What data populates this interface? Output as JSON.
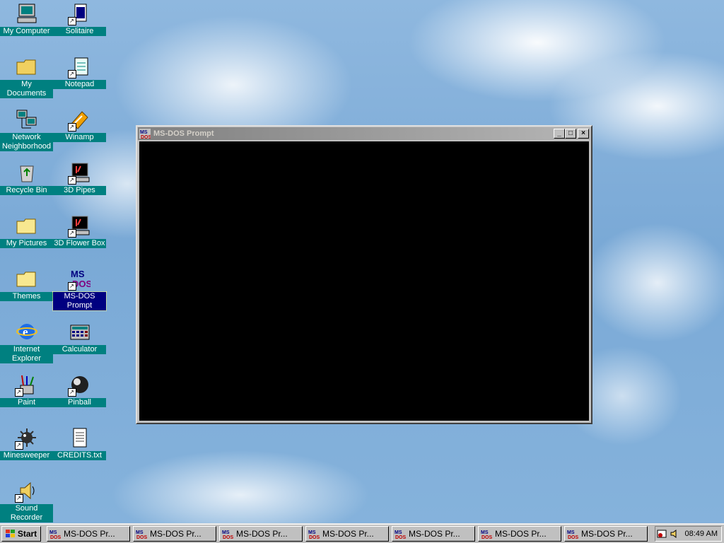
{
  "desktop": {
    "icons": [
      {
        "label": "My Computer"
      },
      {
        "label": "Solitaire"
      },
      {
        "label": "My Documents"
      },
      {
        "label": "Notepad"
      },
      {
        "label": "Network Neighborhood"
      },
      {
        "label": "Winamp"
      },
      {
        "label": "Recycle Bin"
      },
      {
        "label": "3D Pipes"
      },
      {
        "label": "My Pictures"
      },
      {
        "label": "3D Flower Box"
      },
      {
        "label": "Themes"
      },
      {
        "label": "MS-DOS Prompt"
      },
      {
        "label": "Internet Explorer"
      },
      {
        "label": "Calculator"
      },
      {
        "label": "Paint"
      },
      {
        "label": "Pinball"
      },
      {
        "label": "Minesweeper"
      },
      {
        "label": "CREDITS.txt"
      },
      {
        "label": "Sound Recorder"
      }
    ]
  },
  "window": {
    "title": "MS-DOS Prompt",
    "minimize": "_",
    "maximize": "□",
    "close": "×"
  },
  "taskbar": {
    "start_label": "Start",
    "tasks": [
      {
        "label": "MS-DOS Pr..."
      },
      {
        "label": "MS-DOS Pr..."
      },
      {
        "label": "MS-DOS Pr..."
      },
      {
        "label": "MS-DOS Pr..."
      },
      {
        "label": "MS-DOS Pr..."
      },
      {
        "label": "MS-DOS Pr..."
      },
      {
        "label": "MS-DOS Pr..."
      }
    ],
    "clock": "08:49 AM"
  },
  "colors": {
    "desktop_label_bg": "#008080",
    "selected_label_bg": "#000080",
    "console_bg": "#000000"
  }
}
